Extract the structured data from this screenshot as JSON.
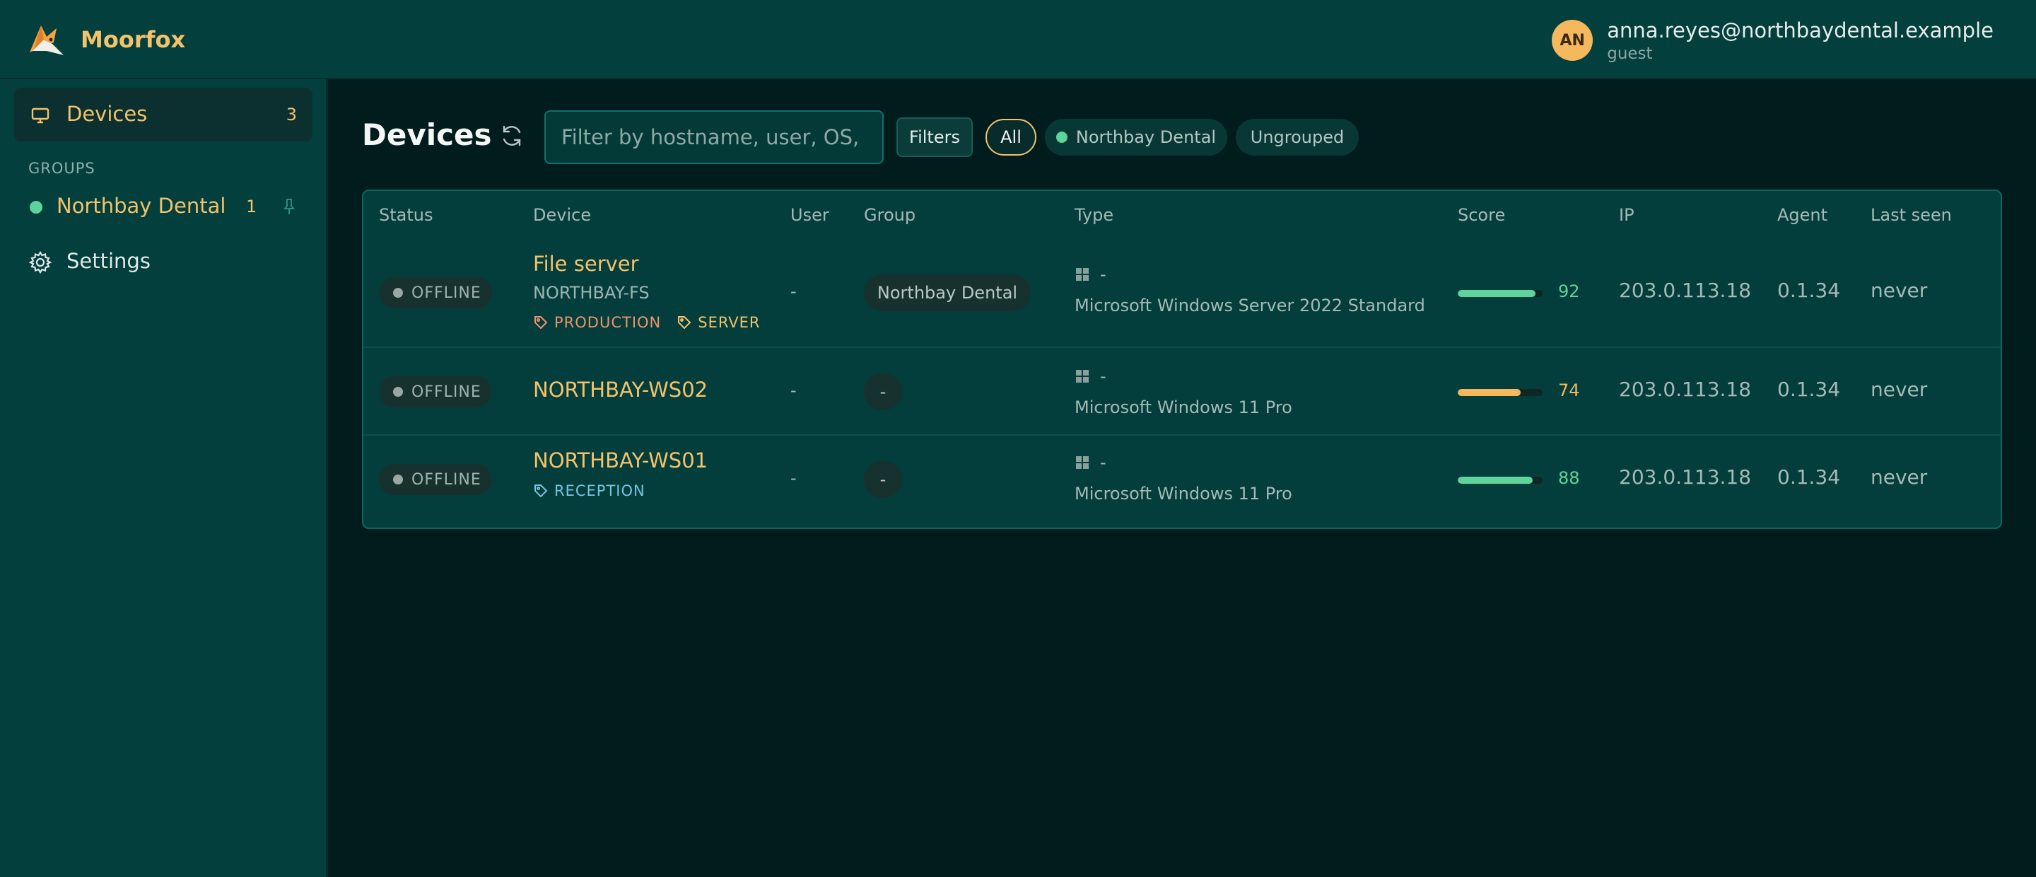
{
  "app": {
    "name": "Moorfox"
  },
  "user": {
    "initials": "AN",
    "email": "anna.reyes@northbaydental.example",
    "role": "guest"
  },
  "sidebar": {
    "devices_label": "Devices",
    "devices_count": "3",
    "groups_heading": "GROUPS",
    "groups": [
      {
        "label": "Northbay Dental",
        "count": "1"
      }
    ],
    "settings_label": "Settings"
  },
  "toolbar": {
    "title": "Devices",
    "search_placeholder": "Filter by hostname, user, OS, IP...",
    "filters_label": "Filters",
    "chips": {
      "all": "All",
      "northbay": "Northbay Dental",
      "ungrouped": "Ungrouped"
    }
  },
  "table": {
    "headers": {
      "status": "Status",
      "device": "Device",
      "user": "User",
      "group": "Group",
      "type": "Type",
      "score": "Score",
      "ip": "IP",
      "agent": "Agent",
      "last_seen": "Last seen"
    },
    "rows": [
      {
        "status": "OFFLINE",
        "name": "File server",
        "host": "NORTHBAY-FS",
        "tags": [
          "PRODUCTION",
          "SERVER"
        ],
        "user": "-",
        "group": "Northbay Dental",
        "type": "-",
        "os": "Microsoft Windows Server 2022 Standard",
        "score": 92,
        "score_label": "92",
        "ip": "203.0.113.18",
        "agent": "0.1.34",
        "last_seen": "never"
      },
      {
        "status": "OFFLINE",
        "name": "NORTHBAY-WS02",
        "host": "",
        "tags": [],
        "user": "-",
        "group": "-",
        "type": "-",
        "os": "Microsoft Windows 11 Pro",
        "score": 74,
        "score_label": "74",
        "ip": "203.0.113.18",
        "agent": "0.1.34",
        "last_seen": "never"
      },
      {
        "status": "OFFLINE",
        "name": "NORTHBAY-WS01",
        "host": "",
        "tags": [
          "RECEPTION"
        ],
        "user": "-",
        "group": "-",
        "type": "-",
        "os": "Microsoft Windows 11 Pro",
        "score": 88,
        "score_label": "88",
        "ip": "203.0.113.18",
        "agent": "0.1.34",
        "last_seen": "never"
      }
    ]
  },
  "colors": {
    "accent": "#f4c26b",
    "score_good": "#5ed49a",
    "score_mid": "#f5b85c",
    "online_dot": "#5ed49a",
    "offline_dot": "#9aa8a5"
  },
  "icons": {
    "brand": "fox-logo-icon",
    "devices": "monitor-icon",
    "settings": "gear-icon",
    "pin": "pin-icon",
    "refresh": "refresh-icon",
    "tag": "tag-icon",
    "os": "windows-icon"
  }
}
